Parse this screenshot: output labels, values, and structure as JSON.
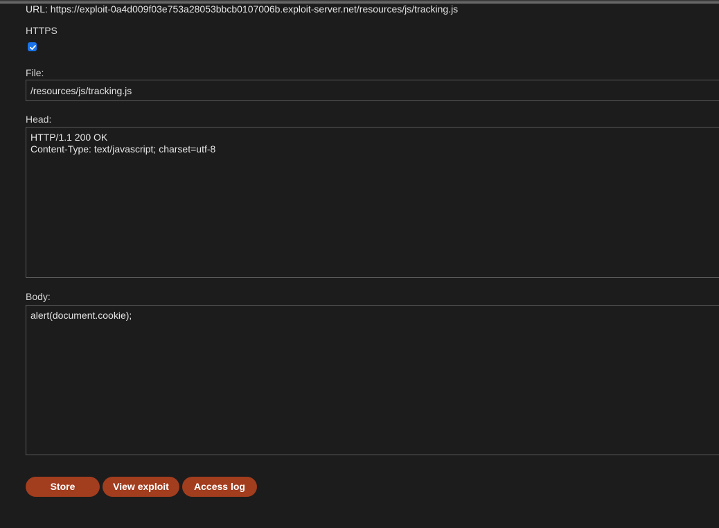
{
  "url_line": "URL: https://exploit-0a4d009f03e753a28053bbcb0107006b.exploit-server.net/resources/js/tracking.js",
  "https": {
    "label": "HTTPS",
    "checked": true
  },
  "file": {
    "label": "File:",
    "value": "/resources/js/tracking.js"
  },
  "head": {
    "label": "Head:",
    "value": "HTTP/1.1 200 OK\nContent-Type: text/javascript; charset=utf-8"
  },
  "body": {
    "label": "Body:",
    "value": "alert(document.cookie);"
  },
  "buttons": {
    "store": "Store",
    "view_exploit": "View exploit",
    "access_log": "Access log"
  },
  "colors": {
    "background": "#1c1c1c",
    "button": "#a23d1e",
    "checkbox": "#1a73e8"
  }
}
